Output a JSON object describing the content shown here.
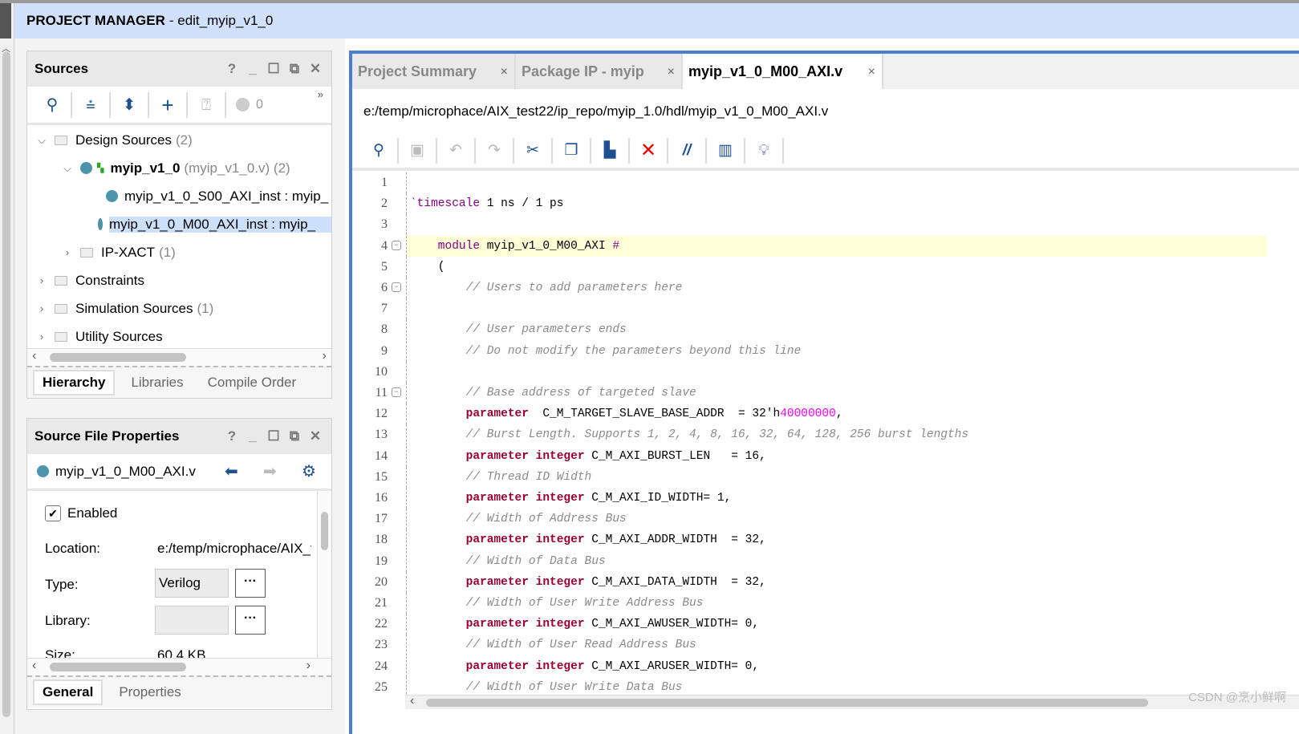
{
  "title": {
    "section": "PROJECT MANAGER",
    "project": "- edit_myip_v1_0"
  },
  "sources": {
    "title": "Sources",
    "controls": [
      "?",
      "_",
      "☐",
      "⧉",
      "✕"
    ],
    "toolbar_count": "0",
    "tree": [
      {
        "label": "Design Sources",
        "count": "(2)",
        "level": 0,
        "chev": "v",
        "icon": "folder"
      },
      {
        "label": "myip_v1_0",
        "extra": "(myip_v1_0.v) (2)",
        "level": 1,
        "chev": "v",
        "icon": "module",
        "bold": true
      },
      {
        "label": "myip_v1_0_S00_AXI_inst : myip_",
        "level": 2,
        "icon": "dot"
      },
      {
        "label": "myip_v1_0_M00_AXI_inst : myip_",
        "level": 2,
        "icon": "dot",
        "selected": true
      },
      {
        "label": "IP-XACT",
        "count": "(1)",
        "level": 1,
        "chev": ">",
        "icon": "folder"
      },
      {
        "label": "Constraints",
        "level": 0,
        "chev": ">",
        "icon": "folder"
      },
      {
        "label": "Simulation Sources",
        "count": "(1)",
        "level": 0,
        "chev": ">",
        "icon": "folder"
      },
      {
        "label": "Utility Sources",
        "level": 0,
        "chev": ">",
        "icon": "folder"
      }
    ],
    "tabs": [
      "Hierarchy",
      "Libraries",
      "Compile Order"
    ]
  },
  "props": {
    "title": "Source File Properties",
    "file": "myip_v1_0_M00_AXI.v",
    "enabled_label": "Enabled",
    "enabled": true,
    "location_label": "Location:",
    "location": "e:/temp/microphace/AIX_t",
    "type_label": "Type:",
    "type": "Verilog",
    "library_label": "Library:",
    "library": "",
    "size_label": "Size:",
    "size": "60.4 KB",
    "more": "···",
    "tabs": [
      "General",
      "Properties"
    ]
  },
  "editor": {
    "tabs": [
      {
        "label": "Project Summary"
      },
      {
        "label": "Package IP - myip"
      },
      {
        "label": "myip_v1_0_M00_AXI.v",
        "active": true
      }
    ],
    "close": "×",
    "path": "e:/temp/microphace/AIX_test22/ip_repo/myip_1.0/hdl/myip_v1_0_M00_AXI.v",
    "highlight_line": 4,
    "fold_lines": [
      4,
      6,
      11
    ],
    "lines": [
      [],
      [
        {
          "t": "`timescale",
          "k": "kw"
        },
        {
          "t": " 1 ns / 1 ps",
          "k": "plain"
        }
      ],
      [],
      [
        {
          "t": "    module",
          "k": "kw"
        },
        {
          "t": " myip_v1_0_M00_AXI ",
          "k": "plain"
        },
        {
          "t": "#",
          "k": "kw"
        }
      ],
      [
        {
          "t": "    (",
          "k": "plain"
        }
      ],
      [
        {
          "t": "        // Users to add parameters here",
          "k": "comment"
        }
      ],
      [],
      [
        {
          "t": "        // User parameters ends",
          "k": "comment"
        }
      ],
      [
        {
          "t": "        // Do not modify the parameters beyond this line",
          "k": "comment"
        }
      ],
      [],
      [
        {
          "t": "        // Base address of targeted slave",
          "k": "comment"
        }
      ],
      [
        {
          "t": "        parameter",
          "k": "param"
        },
        {
          "t": "  C_M_TARGET_SLAVE_BASE_ADDR  = 32'h",
          "k": "plain"
        },
        {
          "t": "40000000",
          "k": "num"
        },
        {
          "t": ",",
          "k": "plain"
        }
      ],
      [
        {
          "t": "        // Burst Length. Supports 1, 2, 4, 8, 16, 32, 64, 128, 256 burst lengths",
          "k": "comment"
        }
      ],
      [
        {
          "t": "        parameter integer",
          "k": "param"
        },
        {
          "t": " C_M_AXI_BURST_LEN   = 16,",
          "k": "plain"
        }
      ],
      [
        {
          "t": "        // Thread ID Width",
          "k": "comment"
        }
      ],
      [
        {
          "t": "        parameter integer",
          "k": "param"
        },
        {
          "t": " C_M_AXI_ID_WIDTH= 1,",
          "k": "plain"
        }
      ],
      [
        {
          "t": "        // Width of Address Bus",
          "k": "comment"
        }
      ],
      [
        {
          "t": "        parameter integer",
          "k": "param"
        },
        {
          "t": " C_M_AXI_ADDR_WIDTH  = 32,",
          "k": "plain"
        }
      ],
      [
        {
          "t": "        // Width of Data Bus",
          "k": "comment"
        }
      ],
      [
        {
          "t": "        parameter integer",
          "k": "param"
        },
        {
          "t": " C_M_AXI_DATA_WIDTH  = 32,",
          "k": "plain"
        }
      ],
      [
        {
          "t": "        // Width of User Write Address Bus",
          "k": "comment"
        }
      ],
      [
        {
          "t": "        parameter integer",
          "k": "param"
        },
        {
          "t": " C_M_AXI_AWUSER_WIDTH= 0,",
          "k": "plain"
        }
      ],
      [
        {
          "t": "        // Width of User Read Address Bus",
          "k": "comment"
        }
      ],
      [
        {
          "t": "        parameter integer",
          "k": "param"
        },
        {
          "t": " C_M_AXI_ARUSER_WIDTH= 0,",
          "k": "plain"
        }
      ],
      [
        {
          "t": "        // Width of User Write Data Bus",
          "k": "comment"
        }
      ]
    ]
  },
  "watermark": "CSDN @烹小鲜啊"
}
